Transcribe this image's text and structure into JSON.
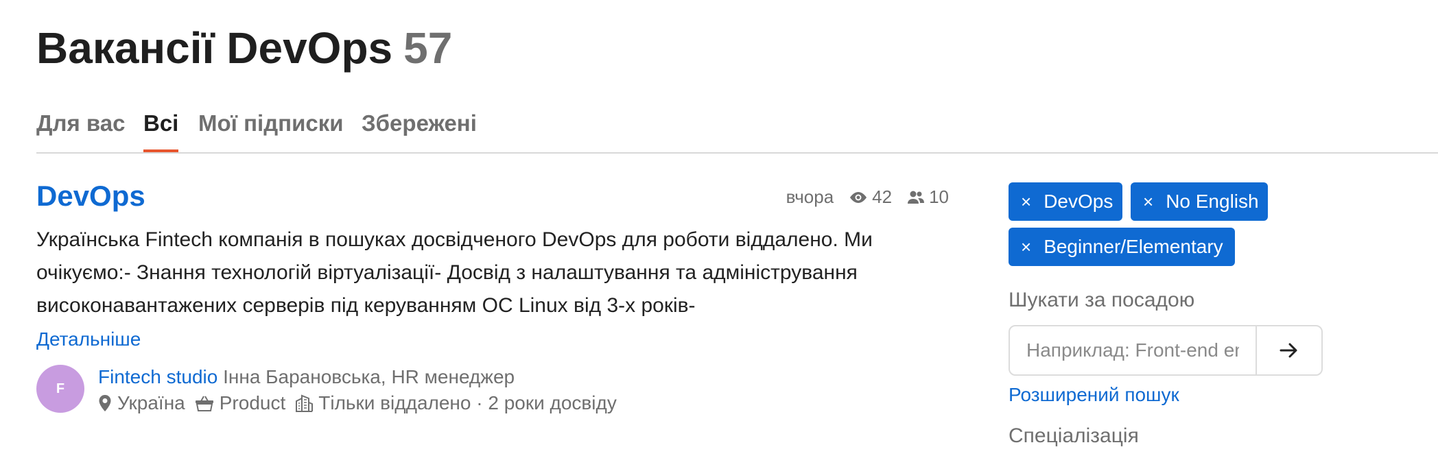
{
  "header": {
    "title": "Вакансії DevOps",
    "count": "57"
  },
  "tabs": [
    {
      "label": "Для вас",
      "active": false
    },
    {
      "label": "Всі",
      "active": true
    },
    {
      "label": "Мої підписки",
      "active": false
    },
    {
      "label": "Збережені",
      "active": false
    }
  ],
  "vacancy": {
    "title": "DevOps",
    "date": "вчора",
    "views": "42",
    "applicants": "10",
    "description": "Українська Fintech компанія в пошуках досвідченого DevOps для роботи віддалено. Ми очікуємо:- Знання технологій віртуалізації- Досвід з налаштування та адміністрування високонавантажених серверів під керуванням ОС Linux від 3-х років-",
    "more_label": "Детальніше",
    "avatar_letter": "F",
    "company": "Fintech studio",
    "recruiter": "Інна Барановська, HR менеджер",
    "location": "Україна",
    "company_type": "Product",
    "work_mode": "Тільки віддалено · 2 роки досвіду"
  },
  "sidebar": {
    "filters": [
      "DevOps",
      "No English",
      "Beginner/Elementary"
    ],
    "remove_glyph": "×",
    "search_label": "Шукати за посадою",
    "search_placeholder": "Наприклад: Front-end engineer",
    "advanced_search": "Розширений пошук",
    "specialization_label": "Спеціалізація"
  },
  "colors": {
    "link": "#0f6ad2",
    "tab_underline": "#e7552d",
    "avatar": "#c89ce0",
    "tag_bg": "#0f6ad2"
  },
  "icons": [
    "eye-icon",
    "users-icon",
    "location-pin-icon",
    "basket-icon",
    "building-icon",
    "arrow-right-icon"
  ]
}
